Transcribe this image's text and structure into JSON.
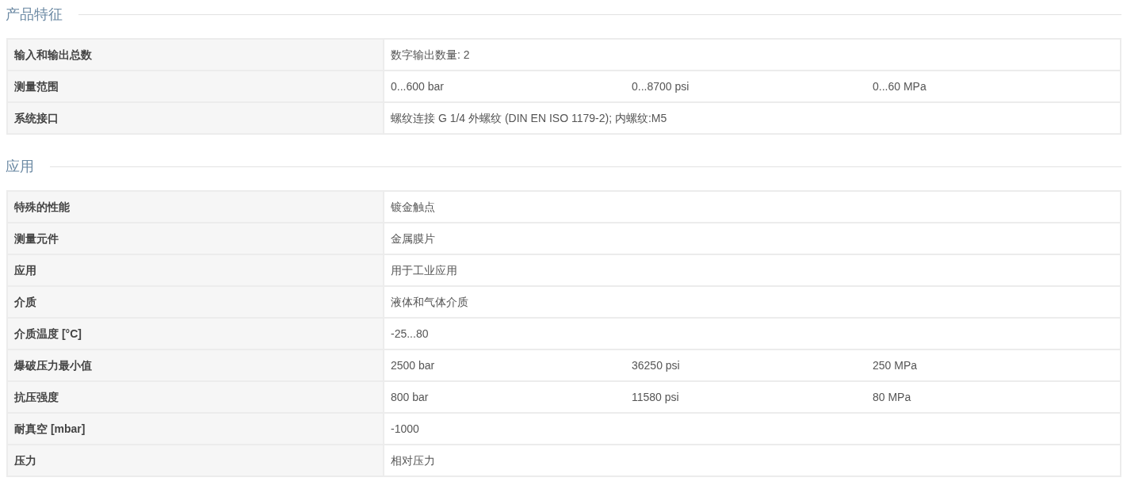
{
  "sections": [
    {
      "title": "产品特征",
      "rows": [
        {
          "label": "输入和输出总数",
          "values": [
            "数字输出数量: 2"
          ]
        },
        {
          "label": "测量范围",
          "values": [
            "0...600 bar",
            "0...8700 psi",
            "0...60 MPa"
          ]
        },
        {
          "label": "系统接口",
          "values": [
            "螺纹连接 G 1/4 外螺纹 (DIN EN ISO 1179-2); 内螺纹:M5"
          ]
        }
      ]
    },
    {
      "title": "应用",
      "rows": [
        {
          "label": "特殊的性能",
          "values": [
            "镀金触点"
          ]
        },
        {
          "label": "测量元件",
          "values": [
            "金属膜片"
          ]
        },
        {
          "label": "应用",
          "values": [
            "用于工业应用"
          ]
        },
        {
          "label": "介质",
          "values": [
            "液体和气体介质"
          ]
        },
        {
          "label": "介质温度 [°C]",
          "values": [
            "-25...80"
          ]
        },
        {
          "label": "爆破压力最小值",
          "values": [
            "2500 bar",
            "36250 psi",
            "250 MPa"
          ]
        },
        {
          "label": "抗压强度",
          "values": [
            "800 bar",
            "11580 psi",
            "80 MPa"
          ]
        },
        {
          "label": "耐真空 [mbar]",
          "values": [
            "-1000"
          ]
        },
        {
          "label": "压力",
          "values": [
            "相对压力"
          ]
        }
      ]
    }
  ]
}
